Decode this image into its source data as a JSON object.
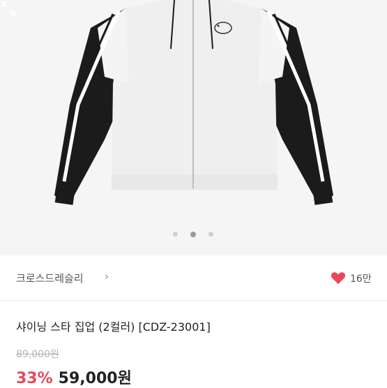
{
  "product": {
    "shop_name": "크로스드레슬리",
    "shop_chevron": "›",
    "likes": "16만",
    "title": "샤이닝 스타 집업 (2컬러) [CDZ-23001]",
    "original_price": "89,000원",
    "discount": "33%",
    "price": "59,000원"
  },
  "carousel": {
    "total": 3,
    "active_index": 1
  },
  "colors": {
    "accent": "#e8485a",
    "heart": "#e8485a",
    "jacket_body": "#f2f2f2",
    "jacket_dark": "#1b1b1b"
  },
  "icons": {
    "heart": "heart-icon",
    "expand": "expand-icon",
    "chevron": "chevron-right-icon"
  }
}
